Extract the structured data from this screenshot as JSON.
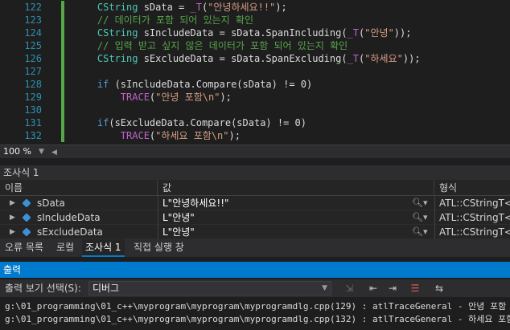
{
  "editor": {
    "lines": [
      {
        "num": "122",
        "indent": "    ",
        "parts": [
          {
            "c": "ty",
            "t": "CString"
          },
          {
            "c": "",
            "t": " sData = "
          },
          {
            "c": "mac",
            "t": "_T"
          },
          {
            "c": "",
            "t": "("
          },
          {
            "c": "st",
            "t": "\"안녕하세요!!\""
          },
          {
            "c": "",
            "t": ");"
          }
        ]
      },
      {
        "num": "123",
        "indent": "    ",
        "parts": [
          {
            "c": "cm",
            "t": "// 데이터가 포함 되어 있는지 확인"
          }
        ]
      },
      {
        "num": "124",
        "indent": "    ",
        "parts": [
          {
            "c": "ty",
            "t": "CString"
          },
          {
            "c": "",
            "t": " sIncludeData = sData.SpanIncluding("
          },
          {
            "c": "mac",
            "t": "_T"
          },
          {
            "c": "",
            "t": "("
          },
          {
            "c": "st",
            "t": "\"안녕\""
          },
          {
            "c": "",
            "t": "));"
          }
        ]
      },
      {
        "num": "125",
        "indent": "    ",
        "parts": [
          {
            "c": "cm",
            "t": "// 입력 받고 싶지 않은 데이터가 포함 되어 있는지 확인"
          }
        ]
      },
      {
        "num": "126",
        "indent": "    ",
        "parts": [
          {
            "c": "ty",
            "t": "CString"
          },
          {
            "c": "",
            "t": " sExcludeData = sData.SpanExcluding("
          },
          {
            "c": "mac",
            "t": "_T"
          },
          {
            "c": "",
            "t": "("
          },
          {
            "c": "st",
            "t": "\"하세요\""
          },
          {
            "c": "",
            "t": "));"
          }
        ]
      },
      {
        "num": "127",
        "indent": "",
        "parts": []
      },
      {
        "num": "128",
        "indent": "    ",
        "parts": [
          {
            "c": "kw",
            "t": "if"
          },
          {
            "c": "",
            "t": " (sIncludeData.Compare(sData) != 0)"
          }
        ]
      },
      {
        "num": "129",
        "indent": "        ",
        "parts": [
          {
            "c": "mac",
            "t": "TRACE"
          },
          {
            "c": "",
            "t": "("
          },
          {
            "c": "st",
            "t": "\"안녕 포함\\n\""
          },
          {
            "c": "",
            "t": ");"
          }
        ]
      },
      {
        "num": "130",
        "indent": "",
        "parts": []
      },
      {
        "num": "131",
        "indent": "    ",
        "parts": [
          {
            "c": "kw",
            "t": "if"
          },
          {
            "c": "",
            "t": "(sExcludeData.Compare(sData) != 0)"
          }
        ]
      },
      {
        "num": "132",
        "indent": "        ",
        "parts": [
          {
            "c": "mac",
            "t": "TRACE"
          },
          {
            "c": "",
            "t": "("
          },
          {
            "c": "st",
            "t": "\"하세요 포함\\n\""
          },
          {
            "c": "",
            "t": ");"
          }
        ]
      }
    ],
    "zoom": "100 %"
  },
  "watch": {
    "title": "조사식 1",
    "col_name": "이름",
    "col_value": "값",
    "col_type": "형식",
    "rows": [
      {
        "name": "sData",
        "value": "L\"안녕하세요!!\"",
        "type": "ATL::CStringT<w..."
      },
      {
        "name": "sIncludeData",
        "value": "L\"안녕\"",
        "type": "ATL::CStringT<w..."
      },
      {
        "name": "sExcludeData",
        "value": "L\"안녕\"",
        "type": "ATL::CStringT<w..."
      }
    ]
  },
  "tabs": [
    "오류 목록",
    "로컬",
    "조사식 1",
    "직접 실행 창"
  ],
  "active_tab": "조사식 1",
  "output": {
    "title": "출력",
    "show_label": "출력 보기 선택(S):",
    "source": "디버그",
    "lines": [
      "g:\\01_programming\\01_c++\\myprogram\\myprogram\\myprogramdlg.cpp(129) : atlTraceGeneral - 안녕 포함",
      "g:\\01_programming\\01_c++\\myprogram\\myprogram\\myprogramdlg.cpp(132) : atlTraceGeneral - 하세요 포함"
    ]
  },
  "icons": [
    "expand-arrow-icon",
    "variable-cube-icon",
    "magnifier-icon",
    "dropdown-caret-icon",
    "find-in-output-icon",
    "prev-message-icon",
    "next-message-icon",
    "clear-all-icon",
    "word-wrap-icon"
  ],
  "colors": {
    "accent": "#007acc",
    "background": "#1e1e1e",
    "change_bar": "#57a64a",
    "line_number": "#2b91af"
  }
}
